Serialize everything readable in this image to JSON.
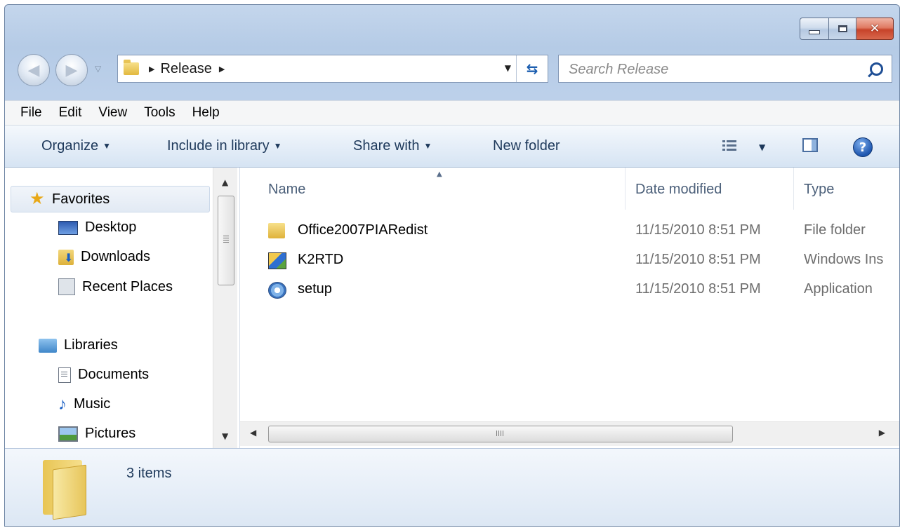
{
  "window": {
    "caption": {
      "minimize": "—",
      "maximize": "□",
      "close": "✕"
    }
  },
  "addressbar": {
    "breadcrumbs": [
      "Release"
    ],
    "separator": "▶",
    "dropdown": "▼"
  },
  "search": {
    "placeholder": "Search Release"
  },
  "menu": {
    "items": [
      "File",
      "Edit",
      "View",
      "Tools",
      "Help"
    ]
  },
  "toolbar": {
    "organize": "Organize",
    "include_in_library": "Include in library",
    "share_with": "Share with",
    "new_folder": "New folder",
    "caret": "▼"
  },
  "navpane": {
    "favorites": "Favorites",
    "favorites_items": [
      "Desktop",
      "Downloads",
      "Recent Places"
    ],
    "libraries": "Libraries",
    "libraries_items": [
      "Documents",
      "Music",
      "Pictures"
    ],
    "icons": {
      "favorites": "star-icon",
      "Desktop": "desktop-icon",
      "Downloads": "downloads-icon",
      "Recent Places": "recent-places-icon",
      "Libraries": "libraries-icon",
      "Documents": "documents-icon",
      "Music": "music-icon",
      "Pictures": "pictures-icon"
    }
  },
  "filelist": {
    "columns": {
      "name": "Name",
      "date": "Date modified",
      "type": "Type"
    },
    "rows": [
      {
        "name": "Office2007PIARedist",
        "date": "11/15/2010 8:51 PM",
        "type": "File folder",
        "icon": "folder-icon"
      },
      {
        "name": "K2RTD",
        "date": "11/15/2010 8:51 PM",
        "type": "Windows Ins",
        "icon": "installer-icon"
      },
      {
        "name": "setup",
        "date": "11/15/2010 8:51 PM",
        "type": "Application",
        "icon": "setup-icon"
      }
    ]
  },
  "status": {
    "item_count": "3 items"
  },
  "colors": {
    "accent": "#1e395b",
    "window_frame": "#b5cbe6",
    "close_button": "#c7432a"
  }
}
